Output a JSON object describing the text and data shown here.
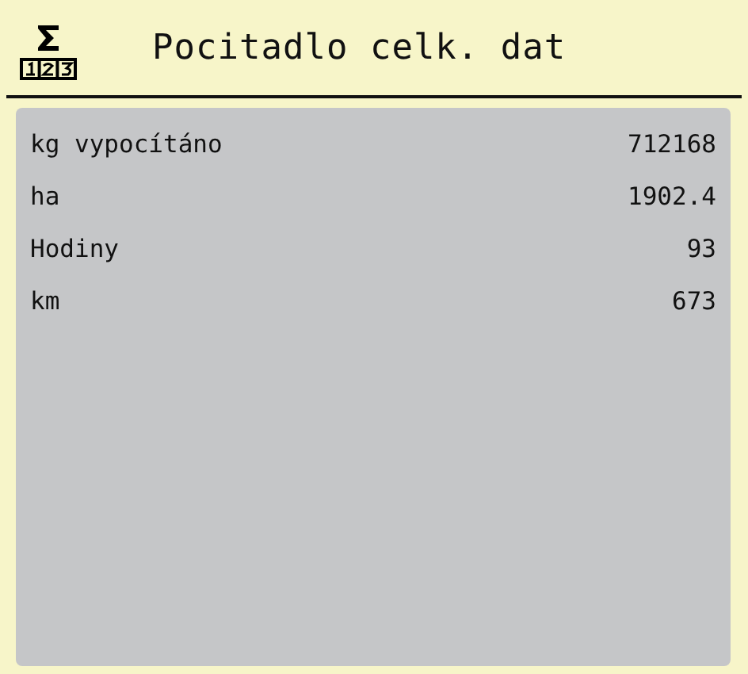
{
  "header": {
    "title": "Pocitadlo celk. dat"
  },
  "rows": [
    {
      "label": "kg vypocítáno",
      "value": "712168"
    },
    {
      "label": "ha",
      "value": "1902.4"
    },
    {
      "label": "Hodiny",
      "value": "93"
    },
    {
      "label": "km",
      "value": "673"
    }
  ]
}
